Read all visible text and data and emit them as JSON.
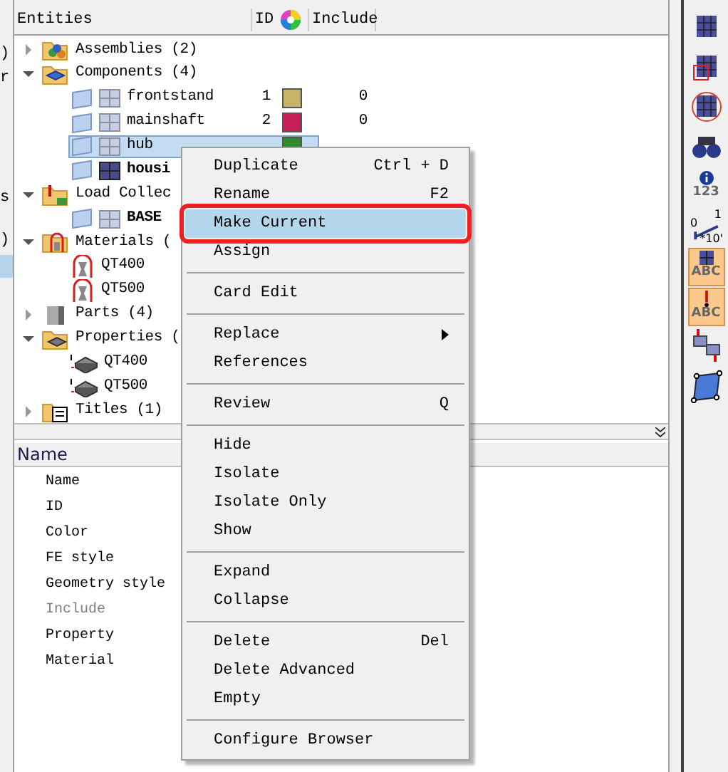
{
  "side_fragments": [
    {
      "text": ")",
      "selected": false
    },
    {
      "text": "r",
      "selected": false
    },
    {
      "text": "s",
      "selected": false
    },
    {
      "text": ")",
      "selected": false
    },
    {
      "selected": true
    }
  ],
  "tree": {
    "columns": [
      "Entities",
      "ID",
      "Include"
    ],
    "items": [
      {
        "kind": "assembly",
        "label": "Assemblies (2)",
        "expanded": false,
        "bold": false,
        "selected": false
      },
      {
        "kind": "component-folder",
        "label": "Components (4)",
        "expanded": true,
        "bold": false,
        "selected": false,
        "children": [
          {
            "kind": "component",
            "label": "frontstand",
            "id": "1",
            "color": "#c8b468",
            "include": "0",
            "bold": false,
            "selected": false
          },
          {
            "kind": "component",
            "label": "mainshaft",
            "id": "2",
            "color": "#c81e5a",
            "include": "0",
            "bold": false,
            "selected": false
          },
          {
            "kind": "component",
            "label": "hub",
            "color": "#2f8a2f",
            "bold": false,
            "selected": true
          },
          {
            "kind": "component-current",
            "label": "housi",
            "bold": true,
            "selected": false
          }
        ]
      },
      {
        "kind": "load-folder",
        "label": "Load Collec",
        "expanded": true,
        "bold": false,
        "selected": false,
        "children": [
          {
            "kind": "component",
            "label": "BASE",
            "bold": true,
            "selected": false
          }
        ]
      },
      {
        "kind": "material-folder",
        "label": "Materials (",
        "expanded": true,
        "bold": false,
        "selected": false,
        "children": [
          {
            "kind": "material",
            "label": "QT400",
            "bold": false,
            "selected": false
          },
          {
            "kind": "material",
            "label": "QT500",
            "bold": false,
            "selected": false
          }
        ]
      },
      {
        "kind": "part",
        "label": "Parts (4)",
        "expanded": false,
        "bold": false,
        "selected": false
      },
      {
        "kind": "property-folder",
        "label": "Properties (",
        "expanded": true,
        "bold": false,
        "selected": false,
        "children": [
          {
            "kind": "property",
            "label": "QT400",
            "bold": false,
            "selected": false
          },
          {
            "kind": "property",
            "label": "QT500",
            "bold": false,
            "selected": false
          }
        ]
      },
      {
        "kind": "title",
        "label": "Titles (1)",
        "expanded": false,
        "bold": false,
        "selected": false
      }
    ]
  },
  "properties": {
    "header": "Name",
    "rows": [
      {
        "label": "Name",
        "disabled": false
      },
      {
        "label": "ID",
        "disabled": false
      },
      {
        "label": "Color",
        "disabled": false
      },
      {
        "label": "FE style",
        "disabled": false
      },
      {
        "label": "Geometry style",
        "disabled": false
      },
      {
        "label": "Include",
        "disabled": true
      },
      {
        "label": "Property",
        "disabled": false
      },
      {
        "label": "Material",
        "disabled": false
      }
    ]
  },
  "context_menu": {
    "groups": [
      [
        {
          "label": "Duplicate",
          "shortcut": "Ctrl + D",
          "selected": false
        },
        {
          "label": "Rename",
          "shortcut": "F2",
          "selected": false
        },
        {
          "label": "Make Current",
          "selected": true,
          "annotated": true
        },
        {
          "label": "Assign",
          "selected": false
        }
      ],
      [
        {
          "label": "Card Edit",
          "selected": false
        }
      ],
      [
        {
          "label": "Replace",
          "submenu": true,
          "selected": false
        },
        {
          "label": "References",
          "selected": false
        }
      ],
      [
        {
          "label": "Review",
          "shortcut": "Q",
          "selected": false
        }
      ],
      [
        {
          "label": "Hide",
          "selected": false
        },
        {
          "label": "Isolate",
          "selected": false
        },
        {
          "label": "Isolate Only",
          "selected": false
        },
        {
          "label": "Show",
          "selected": false
        }
      ],
      [
        {
          "label": "Expand",
          "selected": false
        },
        {
          "label": "Collapse",
          "selected": false
        }
      ],
      [
        {
          "label": "Delete",
          "shortcut": "Del",
          "selected": false
        },
        {
          "label": "Delete Advanced",
          "selected": false
        },
        {
          "label": "Empty",
          "selected": false
        }
      ],
      [
        {
          "label": "Configure Browser",
          "selected": false
        }
      ]
    ]
  },
  "toolbar": [
    {
      "kind": "mesh"
    },
    {
      "kind": "mesh-select"
    },
    {
      "kind": "mesh-circle"
    },
    {
      "kind": "binoculars"
    },
    {
      "kind": "info",
      "caption": "123"
    },
    {
      "kind": "scale",
      "captions": [
        "0",
        "1",
        "*10'"
      ]
    },
    {
      "kind": "mesh-label",
      "caption": "ABC",
      "selected": true
    },
    {
      "kind": "load-label",
      "caption": "ABC",
      "selected": true
    },
    {
      "kind": "reorder"
    },
    {
      "kind": "plane"
    }
  ]
}
